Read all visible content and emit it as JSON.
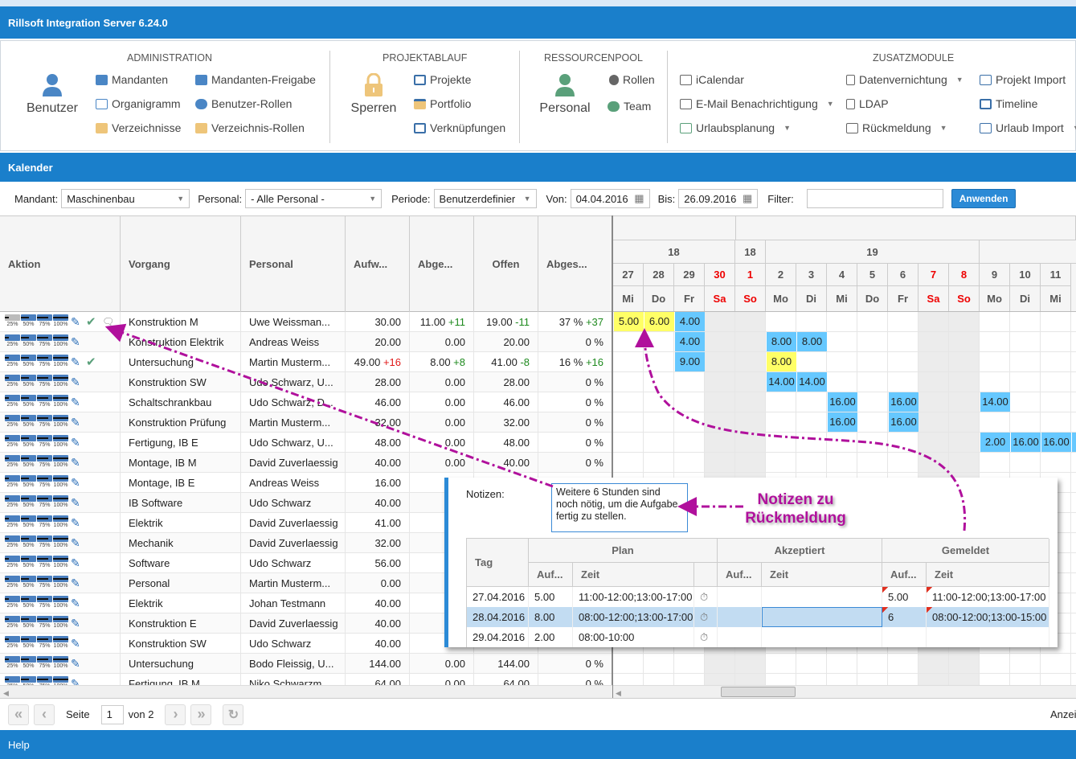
{
  "app": {
    "title": "Rillsoft Integration Server 6.24.0"
  },
  "ribbon": {
    "administration": {
      "title": "ADMINISTRATION",
      "big": "Benutzer",
      "items": [
        "Mandanten",
        "Mandanten-Freigabe",
        "Organigramm",
        "Benutzer-Rollen",
        "Verzeichnisse",
        "Verzeichnis-Rollen"
      ]
    },
    "projektablauf": {
      "title": "PROJEKTABLAUF",
      "big": "Sperren",
      "items": [
        "Projekte",
        "Portfolio",
        "Verknüpfungen"
      ]
    },
    "ressourcenpool": {
      "title": "RESSOURCENPOOL",
      "big": "Personal",
      "items": [
        "Rollen",
        "Team"
      ]
    },
    "zusatzmodule": {
      "title": "ZUSATZMODULE",
      "items": [
        "iCalendar",
        "E-Mail Benachrichtigung",
        "Urlaubsplanung",
        "Datenvernichtung",
        "LDAP",
        "Rückmeldung",
        "Projekt Import",
        "Timeline",
        "Urlaub Import"
      ]
    }
  },
  "section": {
    "title": "Kalender"
  },
  "filter": {
    "mandant_label": "Mandant:",
    "mandant": "Maschinenbau",
    "personal_label": "Personal:",
    "personal": "- Alle Personal -",
    "periode_label": "Periode:",
    "periode": "Benutzerdefinier",
    "von_label": "Von:",
    "von": "04.04.2016",
    "bis_label": "Bis:",
    "bis": "26.09.2016",
    "filter_label": "Filter:",
    "filter_value": "",
    "apply": "Anwenden"
  },
  "table": {
    "columns": [
      "Aktion",
      "Vorgang",
      "Personal",
      "Aufw...",
      "Abge...",
      "Offen",
      "Abges..."
    ],
    "progress_labels": [
      "25%",
      "50%",
      "75%",
      "100%"
    ],
    "rows": [
      {
        "vorgang": "Konstruktion M",
        "personal": "Uwe Weissman...",
        "aufw": "30.00",
        "aufw_d": "",
        "abge": "11.00",
        "abge_d": "+11",
        "offen": "19.00",
        "offen_d": "-11",
        "abges": "37 %",
        "abges_d": "+37",
        "check": true,
        "comment": true,
        "p25_gray": true
      },
      {
        "vorgang": "Konstruktion Elektrik",
        "personal": "Andreas Weiss",
        "aufw": "20.00",
        "abge": "0.00",
        "offen": "20.00",
        "abges": "0 %"
      },
      {
        "vorgang": "Untersuchung",
        "personal": "Martin Musterm...",
        "aufw": "49.00",
        "aufw_d": "+16",
        "abge": "8.00",
        "abge_d": "+8",
        "offen": "41.00",
        "offen_d": "-8",
        "abges": "16 %",
        "abges_d": "+16",
        "check": true
      },
      {
        "vorgang": "Konstruktion SW",
        "personal": "Udo Schwarz, U...",
        "aufw": "28.00",
        "abge": "0.00",
        "offen": "28.00",
        "abges": "0 %"
      },
      {
        "vorgang": "Schaltschrankbau",
        "personal": "Udo Schwarz, D...",
        "aufw": "46.00",
        "abge": "0.00",
        "offen": "46.00",
        "abges": "0 %"
      },
      {
        "vorgang": "Konstruktion Prüfung",
        "personal": "Martin Musterm...",
        "aufw": "32.00",
        "abge": "0.00",
        "offen": "32.00",
        "abges": "0 %"
      },
      {
        "vorgang": "Fertigung, IB E",
        "personal": "Udo Schwarz, U...",
        "aufw": "48.00",
        "abge": "0.00",
        "offen": "48.00",
        "abges": "0 %"
      },
      {
        "vorgang": "Montage, IB M",
        "personal": "David Zuverlaessig",
        "aufw": "40.00",
        "abge": "0.00",
        "offen": "40.00",
        "abges": "0 %"
      },
      {
        "vorgang": "Montage, IB E",
        "personal": "Andreas Weiss",
        "aufw": "16.00"
      },
      {
        "vorgang": "IB Software",
        "personal": "Udo Schwarz",
        "aufw": "40.00"
      },
      {
        "vorgang": "Elektrik",
        "personal": "David Zuverlaessig",
        "aufw": "41.00"
      },
      {
        "vorgang": "Mechanik",
        "personal": "David Zuverlaessig",
        "aufw": "32.00"
      },
      {
        "vorgang": "Software",
        "personal": "Udo Schwarz",
        "aufw": "56.00"
      },
      {
        "vorgang": "Personal",
        "personal": "Martin Musterm...",
        "aufw": "0.00"
      },
      {
        "vorgang": "Elektrik",
        "personal": "Johan Testmann",
        "aufw": "40.00"
      },
      {
        "vorgang": "Konstruktion E",
        "personal": "David Zuverlaessig",
        "aufw": "40.00"
      },
      {
        "vorgang": "Konstruktion SW",
        "personal": "Udo Schwarz",
        "aufw": "40.00"
      },
      {
        "vorgang": "Untersuchung",
        "personal": "Bodo Fleissig, U...",
        "aufw": "144.00",
        "abge": "0.00",
        "offen": "144.00",
        "abges": "0 %"
      },
      {
        "vorgang": "Fertigung, IB M",
        "personal": "Niko Schwarzm...",
        "aufw": "64.00",
        "abge": "0.00",
        "offen": "64.00",
        "abges": "0 %"
      }
    ]
  },
  "calendar": {
    "weeks": [
      "18",
      "18",
      "19"
    ],
    "days": [
      {
        "d": "27",
        "w": "Mi"
      },
      {
        "d": "28",
        "w": "Do"
      },
      {
        "d": "29",
        "w": "Fr"
      },
      {
        "d": "30",
        "w": "Sa",
        "we": true
      },
      {
        "d": "1",
        "w": "So",
        "we": true
      },
      {
        "d": "2",
        "w": "Mo"
      },
      {
        "d": "3",
        "w": "Di"
      },
      {
        "d": "4",
        "w": "Mi"
      },
      {
        "d": "5",
        "w": "Do"
      },
      {
        "d": "6",
        "w": "Fr"
      },
      {
        "d": "7",
        "w": "Sa",
        "we": true
      },
      {
        "d": "8",
        "w": "So",
        "we": true
      },
      {
        "d": "9",
        "w": "Mo"
      },
      {
        "d": "10",
        "w": "Di"
      },
      {
        "d": "11",
        "w": "Mi"
      }
    ],
    "cells": [
      {
        "row": 0,
        "day": 0,
        "v": "5.00",
        "kind": "reported"
      },
      {
        "row": 0,
        "day": 1,
        "v": "6.00",
        "kind": "reported"
      },
      {
        "row": 0,
        "day": 2,
        "v": "4.00",
        "kind": "plan"
      },
      {
        "row": 1,
        "day": 2,
        "v": "4.00",
        "kind": "plan"
      },
      {
        "row": 1,
        "day": 5,
        "v": "8.00",
        "kind": "plan"
      },
      {
        "row": 1,
        "day": 6,
        "v": "8.00",
        "kind": "plan"
      },
      {
        "row": 2,
        "day": 2,
        "v": "9.00",
        "kind": "plan"
      },
      {
        "row": 2,
        "day": 5,
        "v": "8.00",
        "kind": "reported"
      },
      {
        "row": 3,
        "day": 5,
        "v": "14.00",
        "kind": "plan"
      },
      {
        "row": 3,
        "day": 6,
        "v": "14.00",
        "kind": "plan"
      },
      {
        "row": 4,
        "day": 7,
        "v": "16.00",
        "kind": "plan"
      },
      {
        "row": 4,
        "day": 9,
        "v": "16.00",
        "kind": "plan"
      },
      {
        "row": 4,
        "day": 12,
        "v": "14.00",
        "kind": "plan"
      },
      {
        "row": 5,
        "day": 7,
        "v": "16.00",
        "kind": "plan"
      },
      {
        "row": 5,
        "day": 9,
        "v": "16.00",
        "kind": "plan"
      },
      {
        "row": 6,
        "day": 12,
        "v": "2.00",
        "kind": "plan"
      },
      {
        "row": 6,
        "day": 13,
        "v": "16.00",
        "kind": "plan"
      },
      {
        "row": 6,
        "day": 14,
        "v": "16.00",
        "kind": "plan"
      }
    ],
    "colors": {
      "plan": "#66c8ff",
      "reported": "#ffff66",
      "weekend": "#ececec"
    }
  },
  "popup": {
    "notes_label": "Notizen:",
    "notes": "Weitere 6 Stunden sind noch nötig, um die Aufgabe fertig zu stellen.",
    "headers": {
      "tag": "Tag",
      "plan": "Plan",
      "akzeptiert": "Akzeptiert",
      "gemeldet": "Gemeldet",
      "auf": "Auf...",
      "zeit": "Zeit"
    },
    "rows": [
      {
        "tag": "27.04.2016",
        "plan_auf": "5.00",
        "plan_zeit": "11:00-12:00;13:00-17:00",
        "akz_auf": "",
        "akz_zeit": "",
        "gem_auf": "5.00",
        "gem_zeit": "11:00-12:00;13:00-17:00"
      },
      {
        "tag": "28.04.2016",
        "plan_auf": "8.00",
        "plan_zeit": "08:00-12:00;13:00-17:00",
        "akz_auf": "",
        "akz_zeit": "",
        "gem_auf": "6",
        "gem_zeit": "08:00-12:00;13:00-15:00",
        "selected": true
      },
      {
        "tag": "29.04.2016",
        "plan_auf": "2.00",
        "plan_zeit": "08:00-10:00",
        "akz_auf": "",
        "akz_zeit": "",
        "gem_auf": "",
        "gem_zeit": ""
      }
    ]
  },
  "annotation": {
    "line1": "Notizen zu",
    "line2": "Rückmeldung",
    "color": "#b0109c"
  },
  "pager": {
    "page_label": "Seite",
    "page": "1",
    "of_label": "von 2",
    "right_text": "Anzei"
  },
  "footer": {
    "help": "Help"
  }
}
